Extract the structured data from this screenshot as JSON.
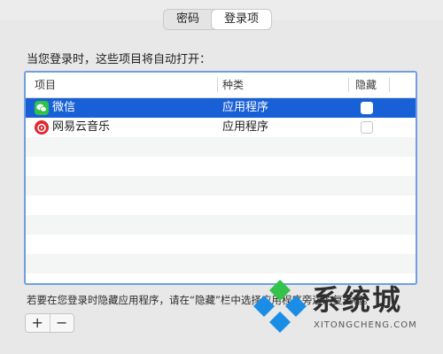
{
  "tabs": [
    {
      "label": "密码",
      "selected": false
    },
    {
      "label": "登录项",
      "selected": true
    }
  ],
  "heading": "当您登录时，这些项目将自动打开：",
  "table": {
    "columns": [
      "项目",
      "种类",
      "隐藏"
    ],
    "rows": [
      {
        "name": "微信",
        "kind": "应用程序",
        "hidden": false,
        "selected": true,
        "icon": "wechat-icon"
      },
      {
        "name": "网易云音乐",
        "kind": "应用程序",
        "hidden": false,
        "selected": false,
        "icon": "netease-music-icon"
      }
    ]
  },
  "footer_note": "若要在您登录时隐藏应用程序，请在“隐藏”栏中选择应用程序旁边的复选框。",
  "buttons": {
    "add": "+",
    "remove": "−"
  },
  "watermark": {
    "title": "系统城",
    "url": "XITONGCHENG.COM"
  },
  "colors": {
    "selection": "#1860d6",
    "focus_ring": "#6f9fe0"
  }
}
